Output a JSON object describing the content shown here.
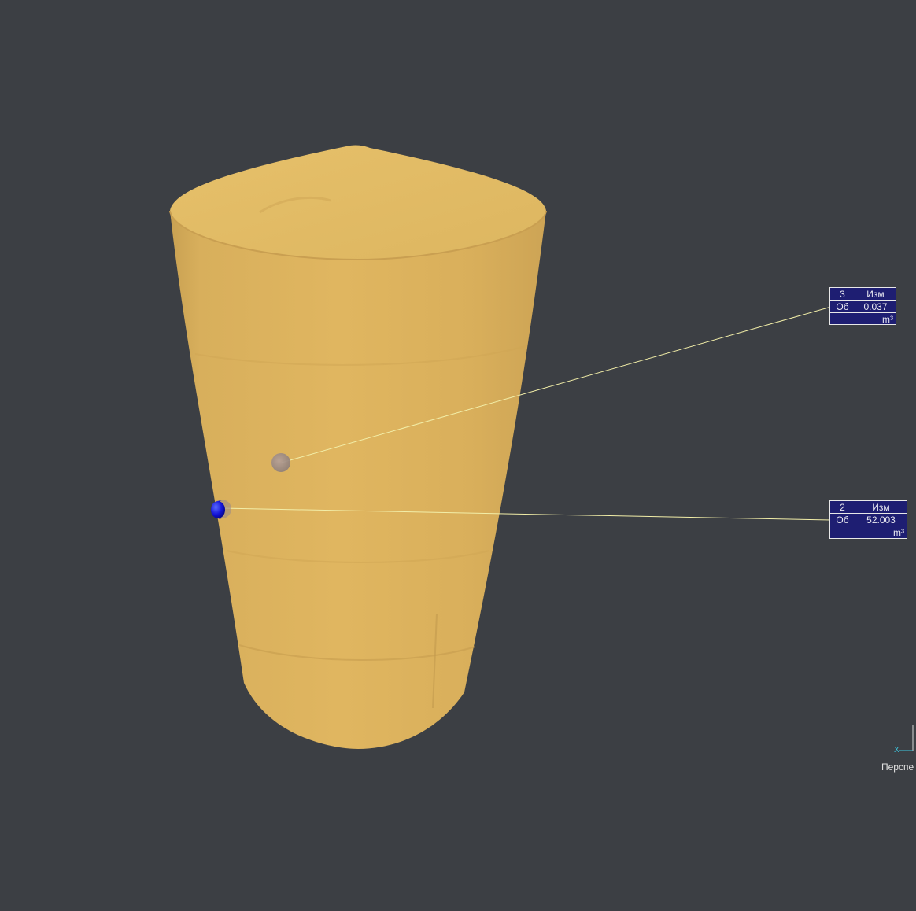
{
  "viewport": {
    "background": "#3c3f44",
    "object_color": "#e1b45c"
  },
  "measurements": [
    {
      "id": "3",
      "header": "Изм",
      "type": "Об",
      "value": "0.037",
      "unit": "m³"
    },
    {
      "id": "2",
      "header": "Изм",
      "type": "Об",
      "value": "52.003",
      "unit": "m³"
    }
  ],
  "axis": {
    "x_label": "X",
    "view_label": "Перспе"
  }
}
